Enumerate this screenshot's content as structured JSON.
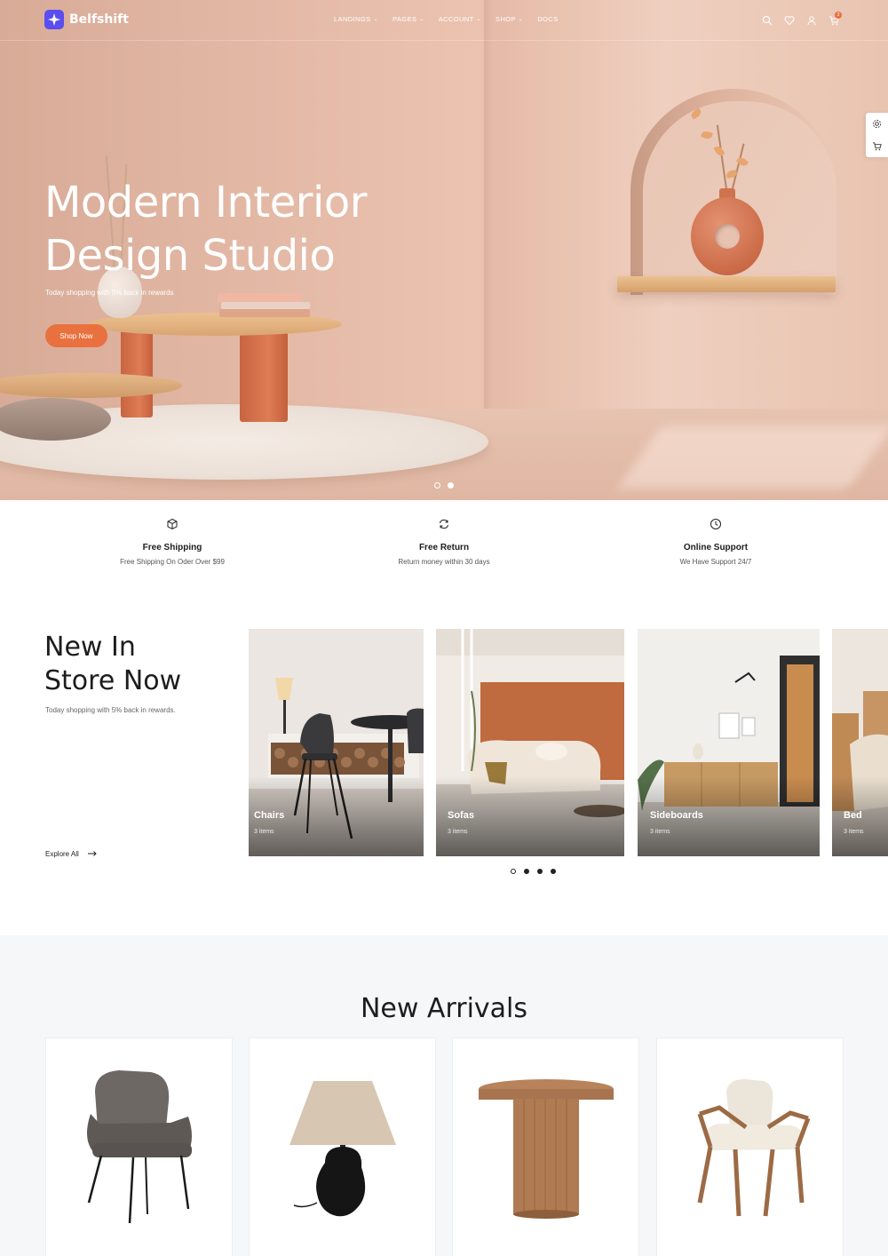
{
  "brand": {
    "name": "Belfshift",
    "accent": "#5b4ef0"
  },
  "nav": {
    "items": [
      {
        "label": "LANDINGS",
        "has_dropdown": true
      },
      {
        "label": "PAGES",
        "has_dropdown": true
      },
      {
        "label": "ACCOUNT",
        "has_dropdown": true
      },
      {
        "label": "SHOP",
        "has_dropdown": true
      },
      {
        "label": "DOCS",
        "has_dropdown": false
      }
    ],
    "icons": [
      "search-icon",
      "heart-icon",
      "user-icon",
      "cart-icon"
    ],
    "cart_count": "3"
  },
  "hero": {
    "title_line1": "Modern Interior",
    "title_line2": "Design Studio",
    "subtitle": "Today shopping with 5% back in rewards",
    "cta": "Shop Now",
    "cta_color": "#e9713f",
    "slides": 2,
    "active_slide": 2
  },
  "side_tools": [
    "settings-icon",
    "cart-icon"
  ],
  "features": [
    {
      "icon": "box-icon",
      "title": "Free Shipping",
      "desc": "Free Shipping On Oder Over $99"
    },
    {
      "icon": "refresh-icon",
      "title": "Free Return",
      "desc": "Return money within 30 days"
    },
    {
      "icon": "clock-icon",
      "title": "Online Support",
      "desc": "We Have Support 24/7"
    }
  ],
  "store": {
    "title_line1": "New In",
    "title_line2": "Store Now",
    "subtitle": "Today shopping with 5% back in rewards.",
    "explore": "Explore All",
    "categories": [
      {
        "name": "Chairs",
        "count": "3 items"
      },
      {
        "name": "Sofas",
        "count": "3 items"
      },
      {
        "name": "Sideboards",
        "count": "3 items"
      },
      {
        "name": "Bed",
        "count": "3 items"
      }
    ],
    "slider_pages": 4,
    "active_page": 1
  },
  "arrivals": {
    "title": "New Arrivals",
    "products": [
      "armchair",
      "table-lamp",
      "side-table",
      "wooden-chair"
    ]
  }
}
